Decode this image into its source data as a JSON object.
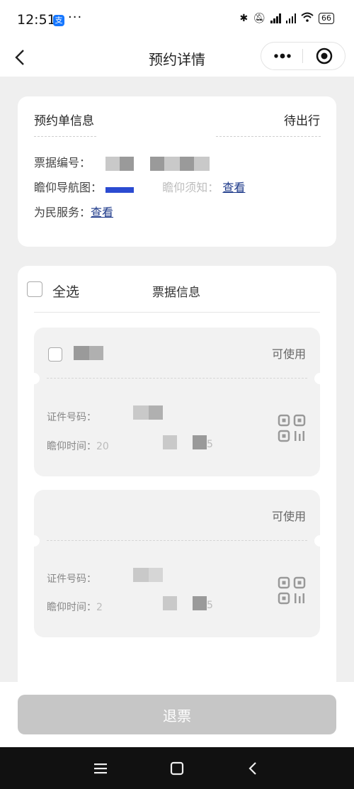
{
  "status_bar": {
    "time": "12:51",
    "alipay_badge": "支",
    "more": "···",
    "battery": "66"
  },
  "nav": {
    "title": "预约详情"
  },
  "booking_info": {
    "header": "预约单信息",
    "status": "待出行",
    "ticket_no_label": "票据编号：",
    "nav_map_label": "瞻仰导航图：",
    "notice_label": "瞻仰须知：",
    "notice_link": "查看",
    "service_label": "为民服务：",
    "service_link": "查看"
  },
  "tickets_section": {
    "select_all": "全选",
    "title": "票据信息",
    "tickets": [
      {
        "status": "可使用",
        "id_label": "证件号码：",
        "time_label": "瞻仰时间：",
        "time_prefix": "20",
        "time_suffix": "5"
      },
      {
        "status": "可使用",
        "id_label": "证件号码：",
        "time_label": "瞻仰时间：",
        "time_prefix": "2",
        "time_suffix": "5"
      }
    ]
  },
  "footer": {
    "refund_button": "退票"
  },
  "colors": {
    "link": "#1e3a8a",
    "disabled_button": "#c6c6c6",
    "background": "#efefef"
  },
  "icons": [
    "back-arrow-icon",
    "more-dots-icon",
    "target-close-icon",
    "qr-code-icon",
    "menu-icon",
    "home-icon",
    "back-icon"
  ]
}
